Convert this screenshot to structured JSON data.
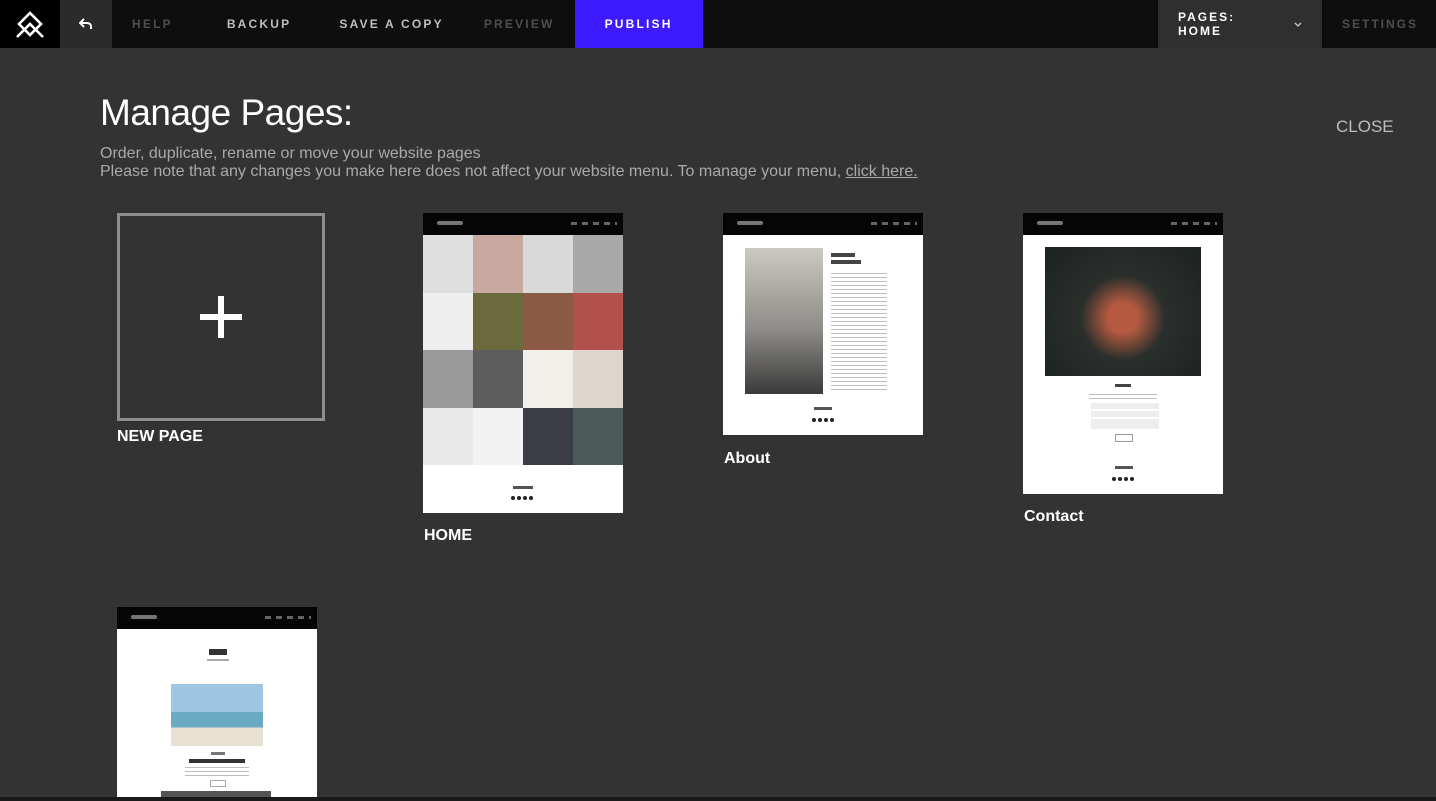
{
  "topbar": {
    "help": "HELP",
    "backup": "BACKUP",
    "save_copy": "SAVE A COPY",
    "preview": "PREVIEW",
    "publish": "PUBLISH",
    "pages_dropdown": "PAGES: HOME",
    "settings": "SETTINGS"
  },
  "main": {
    "title": "Manage Pages:",
    "close": "CLOSE",
    "subtitle_line1": "Order, duplicate, rename or move your website pages",
    "subtitle_line2": "Please note that any changes you make here does not affect your website menu. To manage your menu,",
    "subtitle_link": "click here."
  },
  "pages": {
    "new_page": "NEW PAGE",
    "home": "HOME",
    "about": "About",
    "contact": "Contact"
  },
  "colors": {
    "publish": "#3d1aff",
    "background": "#333333"
  }
}
